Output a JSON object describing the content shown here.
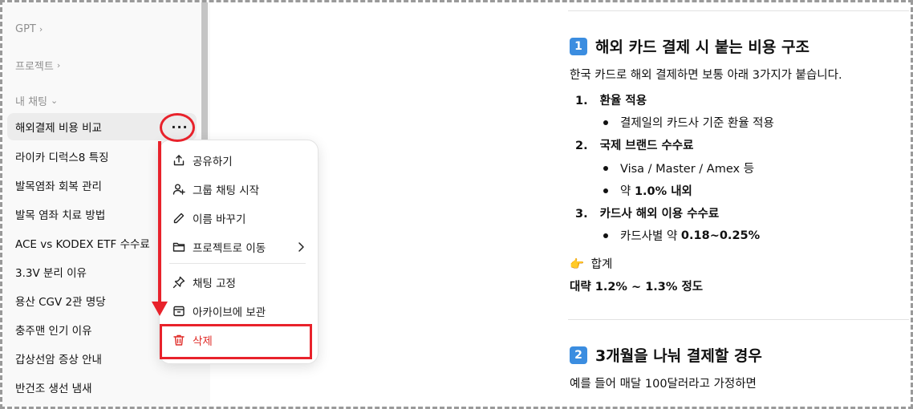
{
  "sidebar": {
    "gpt_label": "GPT",
    "projects_label": "프로젝트",
    "my_chats_label": "내 채팅",
    "chats": [
      {
        "title": "해외결제 비용 비교"
      },
      {
        "title": "라이카 디럭스8 특징"
      },
      {
        "title": "발목염좌 회복 관리"
      },
      {
        "title": "발목 염좌 치료 방법"
      },
      {
        "title": "ACE vs KODEX ETF 수수료"
      },
      {
        "title": "3.3V 분리 이유"
      },
      {
        "title": "용산 CGV 2관 명당"
      },
      {
        "title": "충주맨 인기 이유"
      },
      {
        "title": "갑상선암 증상 안내"
      },
      {
        "title": "반건조 생선 냄새"
      }
    ],
    "more_glyph": "···"
  },
  "menu": {
    "share": "공유하기",
    "group_chat": "그룹 채팅 시작",
    "rename": "이름 바꾸기",
    "move_to_project": "프로젝트로 이동",
    "pin": "채팅 고정",
    "archive": "아카이브에 보관",
    "delete": "삭제"
  },
  "content": {
    "s1_badge": "1",
    "s1_title": "해외 카드 결제 시 붙는 비용 구조",
    "s1_intro": "한국 카드로 해외 결제하면 보통 아래 3가지가 붙습니다.",
    "items": [
      {
        "num": "1.",
        "title": "환율 적용"
      },
      {
        "num": "2.",
        "title": "국제 브랜드 수수료"
      },
      {
        "num": "3.",
        "title": "카드사 해외 이용 수수료"
      }
    ],
    "b1": "결제일의 카드사 기준 환율 적용",
    "b2": "Visa / Master / Amex 등",
    "b3_prefix": "약 ",
    "b3_bold": "1.0% 내외",
    "b4_prefix": "카드사별 약 ",
    "b4_bold": "0.18~0.25%",
    "total_emoji": "👉",
    "total_label": "합계",
    "total_value": "대략 1.2% ~ 1.3% 정도",
    "s2_badge": "2",
    "s2_title": "3개월을 나눠 결제할 경우",
    "s2_intro": "예를 들어 매달 100달러라고 가정하면"
  },
  "colors": {
    "highlight_red": "#e8222b",
    "danger_text": "#e02e2a",
    "badge_blue": "#3b8de0"
  }
}
